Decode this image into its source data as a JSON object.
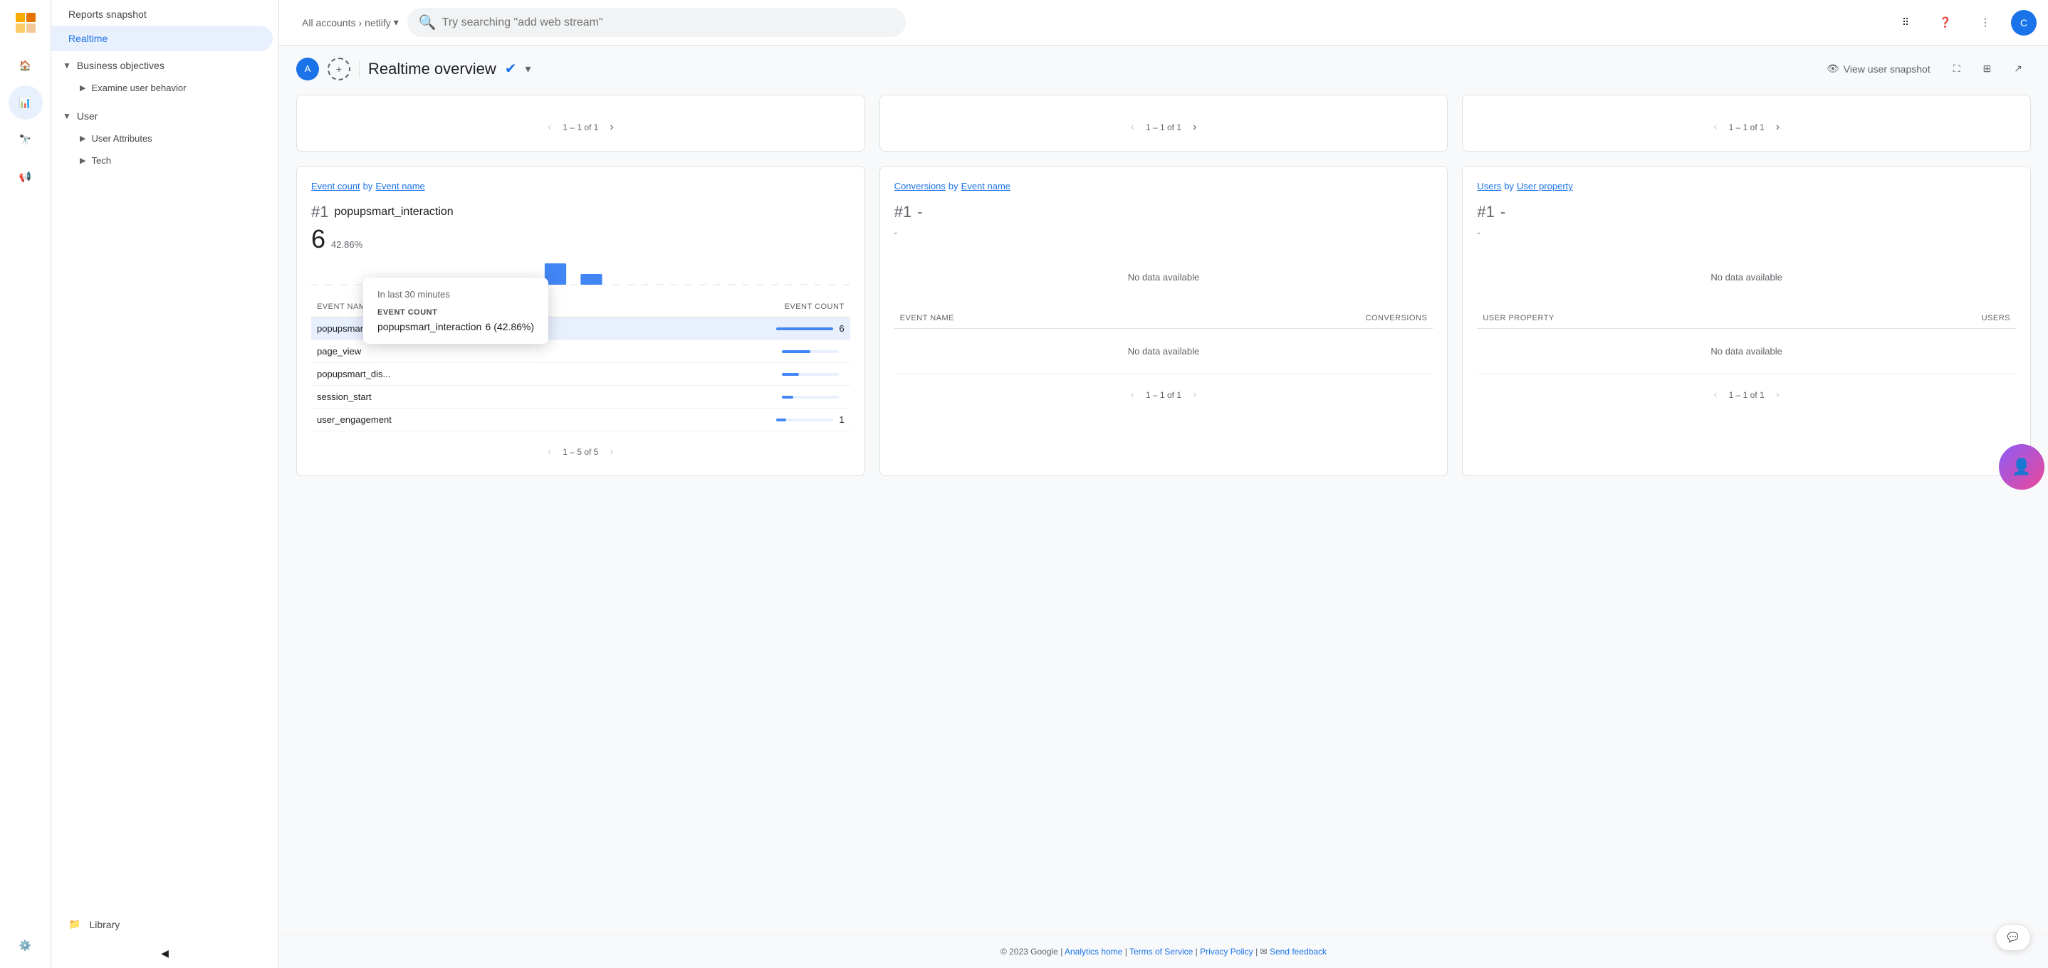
{
  "app": {
    "title": "Analytics",
    "logoColor": "#F9AB00"
  },
  "topbar": {
    "search_placeholder": "Try searching \"add web stream\"",
    "accounts_label": "All accounts",
    "account_name": "netlify",
    "avatar_initials": "C"
  },
  "sidebar": {
    "reports_header": "Reports snapshot",
    "realtime_label": "Realtime",
    "sections": [
      {
        "id": "business-objectives",
        "label": "Business objectives",
        "expanded": true,
        "children": [
          {
            "id": "examine-user-behavior",
            "label": "Examine user behavior"
          }
        ]
      },
      {
        "id": "user",
        "label": "User",
        "expanded": true,
        "children": [
          {
            "id": "user-attributes",
            "label": "User Attributes"
          },
          {
            "id": "tech",
            "label": "Tech"
          }
        ]
      }
    ],
    "library_label": "Library",
    "settings_label": "Settings",
    "collapse_label": "Collapse"
  },
  "page": {
    "title": "Realtime overview",
    "view_snapshot_label": "View user snapshot",
    "filter_avatar": "A"
  },
  "cards": [
    {
      "id": "event-count-card",
      "title_prefix": "Event count",
      "title_by": "by",
      "title_dimension": "Event name",
      "rank": "#1",
      "dash": "",
      "top_event": "popupsmart_interaction",
      "top_count": "6",
      "top_percent": "42.86%",
      "columns": [
        "EVENT NAME",
        "EVENT COUNT"
      ],
      "rows": [
        {
          "name": "popupsmart_interaction",
          "count": "6",
          "bar_pct": 100,
          "highlighted": true
        },
        {
          "name": "page_view",
          "count": "",
          "bar_pct": 50,
          "highlighted": false
        },
        {
          "name": "popupsmart_dis...",
          "count": "",
          "bar_pct": 30,
          "highlighted": false
        },
        {
          "name": "session_start",
          "count": "",
          "bar_pct": 20,
          "highlighted": false
        },
        {
          "name": "user_engagement",
          "count": "1",
          "bar_pct": 17,
          "highlighted": false
        }
      ],
      "pagination": "1 – 5 of 5",
      "has_data": true
    },
    {
      "id": "conversions-card",
      "title_prefix": "Conversions",
      "title_by": "by",
      "title_dimension": "Event name",
      "rank": "#1",
      "dash": "-",
      "top_event": "",
      "top_count": "",
      "top_percent": "",
      "columns": [
        "EVENT NAME",
        "CONVERSIONS"
      ],
      "rows": [],
      "pagination": "1 – 1 of 1",
      "has_data": false,
      "no_data_text": "No data available"
    },
    {
      "id": "users-card",
      "title_prefix": "Users",
      "title_by": "by",
      "title_dimension": "User property",
      "rank": "#1",
      "dash": "-",
      "top_event": "",
      "top_count": "",
      "top_percent": "",
      "columns": [
        "USER PROPERTY",
        "USERS"
      ],
      "rows": [],
      "pagination": "1 – 1 of 1",
      "has_data": false,
      "no_data_text": "No data available"
    }
  ],
  "tooltip": {
    "header": "In last 30 minutes",
    "label": "EVENT COUNT",
    "event_name": "popupsmart_interaction",
    "value": "6 (42.86%)"
  },
  "footer": {
    "copyright": "© 2023 Google",
    "links": [
      "Analytics home",
      "Terms of Service",
      "Privacy Policy"
    ]
  },
  "pagination_prev": "‹",
  "pagination_next": "›"
}
